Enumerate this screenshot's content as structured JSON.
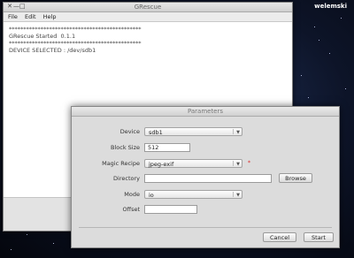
{
  "desktop": {
    "user": "welemski"
  },
  "main_window": {
    "title": "GRescue",
    "controls": [
      "✕",
      "—",
      "□"
    ],
    "menu": [
      "File",
      "Edit",
      "Help"
    ],
    "log_lines": [
      "**********************************************",
      "GRescue Started  0.1.1",
      "**********************************************",
      "",
      "",
      "DEVICE SELECTED : /dev/sdb1"
    ]
  },
  "dialog": {
    "title": "Parameters",
    "fields": {
      "device": {
        "label": "Device",
        "value": "sdb1"
      },
      "block_size": {
        "label": "Block Size",
        "value": "512"
      },
      "magic_recipe": {
        "label": "Magic Recipe",
        "value": "jpeg-exif"
      },
      "directory": {
        "label": "Directory",
        "value": ""
      },
      "mode": {
        "label": "Mode",
        "value": "io"
      },
      "offset": {
        "label": "Offset",
        "value": ""
      }
    },
    "required_mark": "*",
    "browse_label": "Browse",
    "cancel_label": "Cancel",
    "start_label": "Start"
  },
  "colors": {
    "required": "#dd2222",
    "desktop": "#0d1428"
  }
}
